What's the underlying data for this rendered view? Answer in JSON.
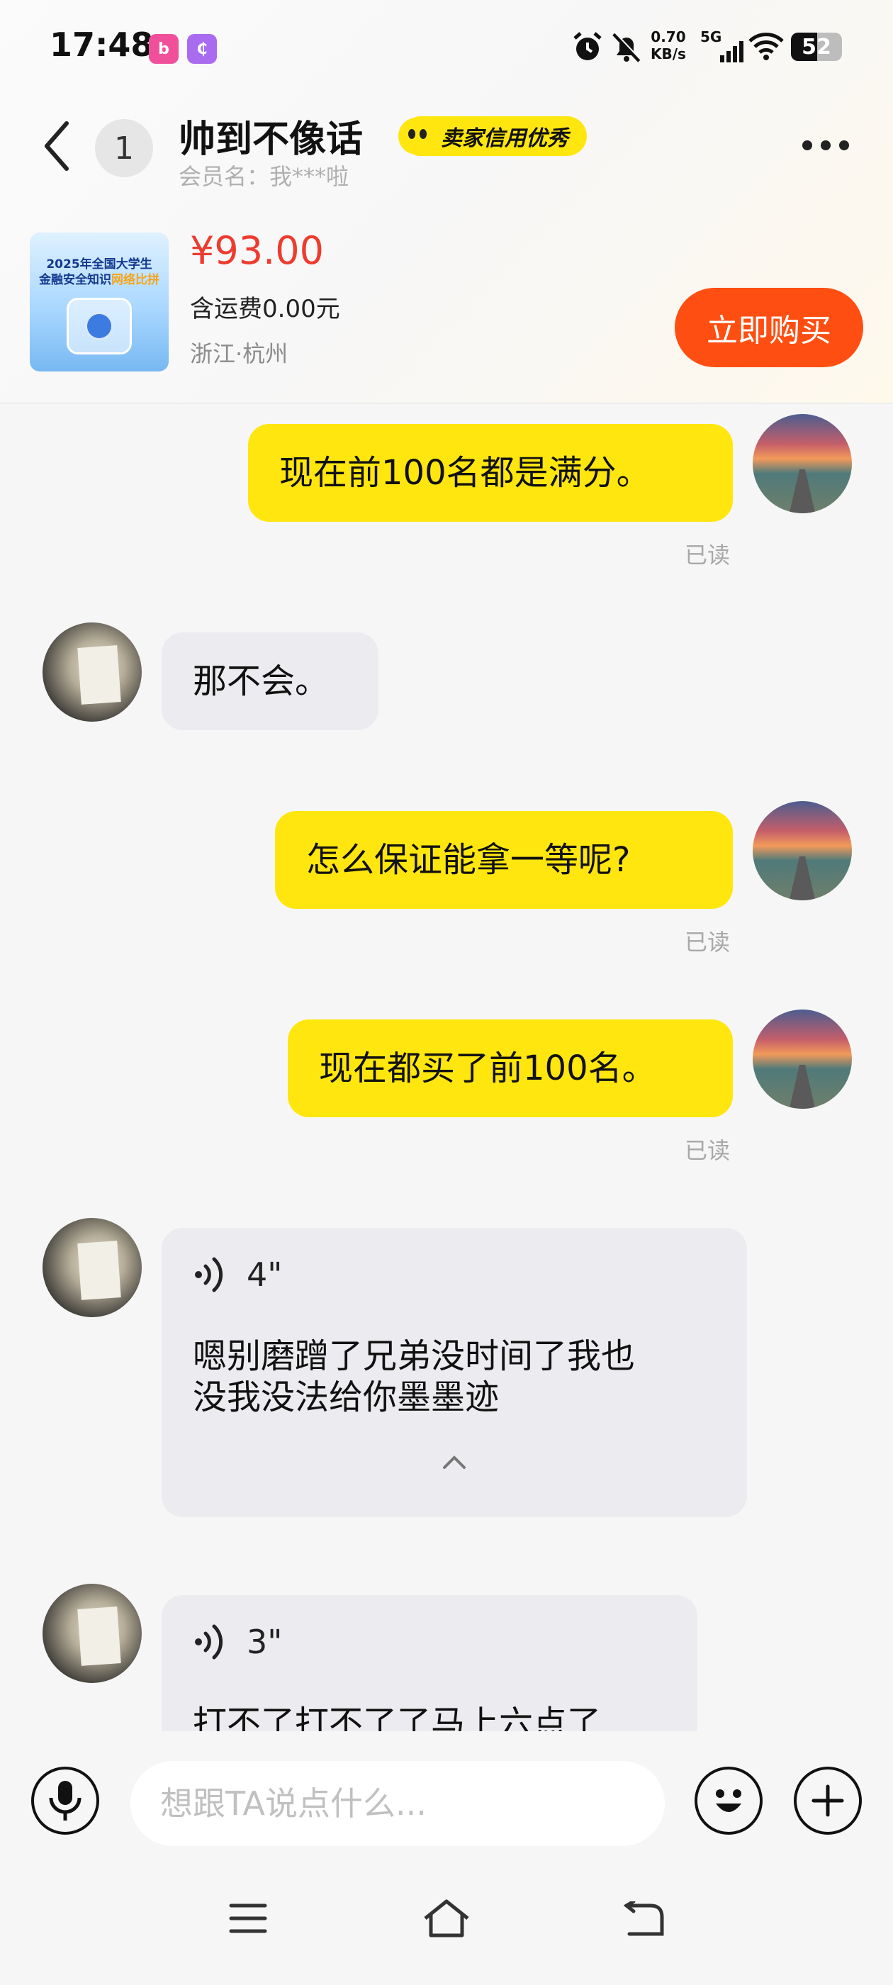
{
  "status_bar": {
    "time": "17:48",
    "net_speed_value": "0.70",
    "net_speed_unit": "KB/s",
    "network": "5G",
    "battery": "52",
    "battery_level": 0.52
  },
  "header": {
    "unread_count": "1",
    "title": "帅到不像话",
    "credit_badge": "卖家信用优秀",
    "member_label": "会员名：我***啦"
  },
  "product": {
    "thumb_title_line1": "2025年全国大学生",
    "thumb_title_line2a": "金融安全知识",
    "thumb_title_line2b": "网络比拼",
    "price": "¥93.00",
    "shipping": "含运费0.00元",
    "location": "浙江·杭州",
    "buy_label": "立即购买"
  },
  "messages": [
    {
      "from": "self",
      "text": "现在前100名都是满分。",
      "status": "已读"
    },
    {
      "from": "other",
      "text": "那不会。"
    },
    {
      "from": "self",
      "text": "怎么保证能拿一等呢?",
      "status": "已读"
    },
    {
      "from": "self",
      "text": "现在都买了前100名。",
      "status": "已读"
    },
    {
      "from": "other",
      "type": "voice",
      "duration": "4\"",
      "line1": "嗯别磨蹭了兄弟没时间了我也",
      "line2": "没我没法给你墨墨迹"
    },
    {
      "from": "other",
      "type": "voice",
      "duration": "3\"",
      "line1": "打不了打不了了马上六点了"
    }
  ],
  "input": {
    "placeholder": "想跟TA说点什么..."
  },
  "colors": {
    "accent_yellow": "#ffe60f",
    "buy_orange": "#ff4e12",
    "price_red": "#ee3b2f"
  }
}
